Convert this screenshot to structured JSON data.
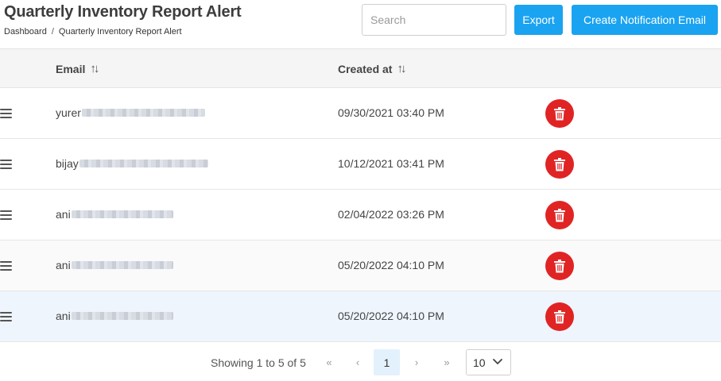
{
  "header": {
    "title": "Quarterly Inventory Report Alert",
    "breadcrumb": [
      "Dashboard",
      "Quarterly Inventory Report Alert"
    ],
    "breadcrumb_separator": "/"
  },
  "toolbar": {
    "search_placeholder": "Search",
    "search_value": "",
    "export_label": "Export",
    "create_label": "Create Notification Email"
  },
  "table": {
    "columns": [
      "Email",
      "Created at"
    ],
    "rows": [
      {
        "email_prefix": "yurer",
        "created_at": "09/30/2021 03:40 PM"
      },
      {
        "email_prefix": "bijay",
        "created_at": "10/12/2021 03:41 PM"
      },
      {
        "email_prefix": "ani",
        "created_at": "02/04/2022 03:26 PM"
      },
      {
        "email_prefix": "ani",
        "created_at": "05/20/2022 04:10 PM"
      },
      {
        "email_prefix": "ani",
        "created_at": "05/20/2022 04:10 PM"
      }
    ]
  },
  "pagination": {
    "info": "Showing 1 to 5 of 5",
    "first_icon": "«",
    "prev_icon": "‹",
    "current_page": "1",
    "next_icon": "›",
    "last_icon": "»",
    "per_page": "10"
  },
  "icons": {
    "sort": "sort-arrows-icon",
    "row_handle": "drag-handle-icon",
    "delete": "trash-icon",
    "dropdown": "chevron-down-icon"
  },
  "colors": {
    "primary_button": "#1aa3f0",
    "delete_button": "#e02424",
    "selected_row": "#eef5fd",
    "current_page_bg": "#e3f1fc"
  }
}
